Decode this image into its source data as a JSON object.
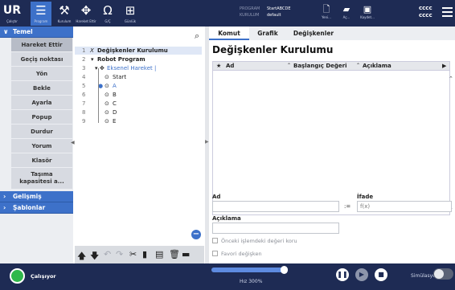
{
  "topbar": {
    "icons": [
      {
        "name": "logo-icon",
        "label": "Çalıştır"
      },
      {
        "name": "program-icon",
        "label": "Program"
      },
      {
        "name": "kurulum-icon",
        "label": "Kurulum"
      },
      {
        "name": "hareket-icon",
        "label": "Hareket Ettir"
      },
      {
        "name": "gc-icon",
        "label": "G/Ç"
      },
      {
        "name": "gunluk-icon",
        "label": "Günlük"
      }
    ],
    "program_label": "PROGRAM",
    "program_value": "StartABCDE",
    "kurulum_label": "KURULUM",
    "kurulum_value": "default",
    "file_buttons": [
      "Yeni...",
      "Aç...",
      "Kaydet..."
    ],
    "cccc_1": "cccc",
    "cccc_2": "cccc"
  },
  "sidebar": {
    "section_basic": "Temel",
    "items": [
      "Hareket Ettir",
      "Geçiş noktası",
      "Yön",
      "Bekle",
      "Ayarla",
      "Popup",
      "Durdur",
      "Yorum",
      "Klasör",
      "Taşıma kapasitesi a..."
    ],
    "item_twoline": [
      "Taşıma",
      "kapasitesi a..."
    ],
    "section_advanced": "Gelişmiş",
    "section_templates": "Şablonlar"
  },
  "tree": {
    "rows": [
      {
        "num": "1",
        "icon": "X",
        "text": "Değişkenler Kurulumu"
      },
      {
        "num": "2",
        "icon": "▾",
        "text": "Robot Program"
      },
      {
        "num": "3",
        "icon": "✥",
        "text": "Eksenel Hareket |"
      },
      {
        "num": "4",
        "icon": "⊙",
        "text": "Start"
      },
      {
        "num": "5",
        "icon": "⊙",
        "text": "A"
      },
      {
        "num": "6",
        "icon": "⊙",
        "text": "B"
      },
      {
        "num": "7",
        "icon": "⊙",
        "text": "C"
      },
      {
        "num": "8",
        "icon": "⊙",
        "text": "D"
      },
      {
        "num": "9",
        "icon": "⊙",
        "text": "E"
      }
    ]
  },
  "right": {
    "tabs": [
      "Komut",
      "Grafik",
      "Değişkenler"
    ],
    "title": "Değişkenler Kurulumu",
    "columns": {
      "star": "★",
      "name": "Ad",
      "initial": "Başlangıç Değeri",
      "desc": "Açıklama"
    },
    "field_ad": "Ad",
    "field_ifade": "İfade",
    "ifade_placeholder": "f(x)",
    "assign": ":=",
    "field_aciklama": "Açıklama",
    "check_keep": "Önceki işlemdeki değeri koru",
    "check_fav": "Favori değişken"
  },
  "bottom": {
    "status": "Çalışıyor",
    "speed_fraction": 1.0,
    "speed_label": "Hız 300%",
    "simulation": "Simülasyon"
  }
}
